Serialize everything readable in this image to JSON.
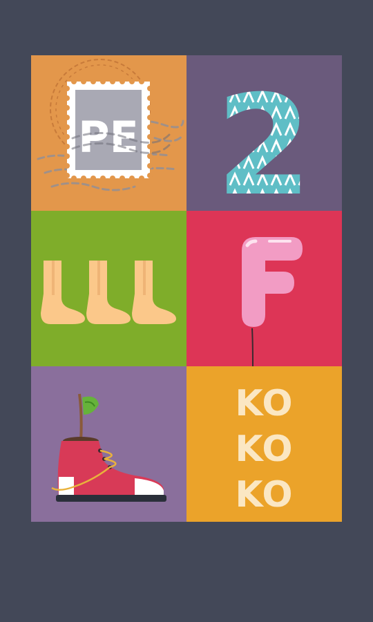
{
  "puzzle": {
    "tiles": [
      {
        "id": "stamp",
        "icon": "postage-stamp-icon",
        "label": "PE",
        "color": "#e3974b"
      },
      {
        "id": "number",
        "icon": "number-two-icon",
        "label": "2",
        "color": "#6a5a7c"
      },
      {
        "id": "feet",
        "icon": "three-feet-icon",
        "color": "#7fad2a"
      },
      {
        "id": "balloon",
        "icon": "letter-f-balloon-icon",
        "label": "F",
        "color": "#dd3556"
      },
      {
        "id": "shoe",
        "icon": "shoe-plant-pot-icon",
        "color": "#8a6f9c"
      },
      {
        "id": "ko",
        "icon": "ko-text",
        "lines": [
          "KO",
          "KO",
          "KO"
        ],
        "color": "#eba32a"
      }
    ]
  },
  "colors": {
    "background": "#434858",
    "stamp_gray": "#a9a9b4",
    "number_teal": "#5fbec6",
    "foot_skin": "#fbc88a",
    "balloon_pink": "#f29cc4",
    "shoe_red": "#d83a57",
    "ko_cream": "#fbe7c3"
  }
}
